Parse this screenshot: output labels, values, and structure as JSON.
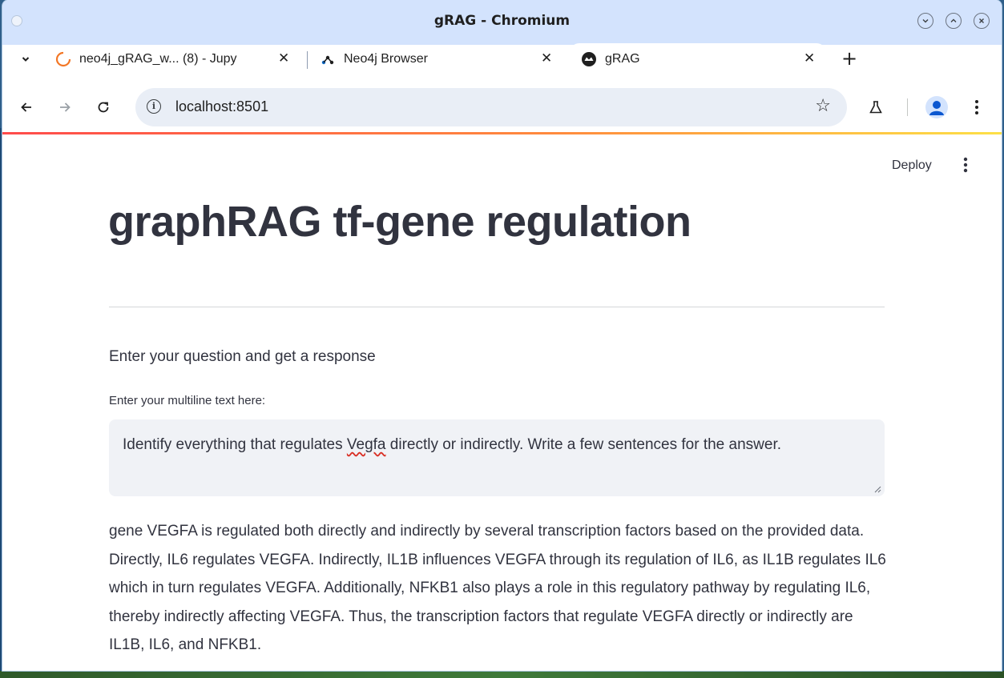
{
  "window": {
    "title": "gRAG - Chromium"
  },
  "tabs": [
    {
      "label": "neo4j_gRAG_w... (8) - Jupy",
      "icon": "jupyter-spinner-icon",
      "active": false
    },
    {
      "label": "Neo4j Browser",
      "icon": "neo4j-icon",
      "active": false
    },
    {
      "label": "gRAG",
      "icon": "streamlit-icon",
      "active": true
    }
  ],
  "toolbar": {
    "url": "localhost:8501"
  },
  "app": {
    "deploy_label": "Deploy",
    "title": "graphRAG tf-gene regulation",
    "subheader": "Enter your question and get a response",
    "input_label": "Enter your multiline text here:",
    "input_value_before": "Identify everything that regulates ",
    "input_value_misspelled": "Vegfa",
    "input_value_after": " directly or indirectly. Write a few sentences for the answer.",
    "answer": "gene VEGFA is regulated both directly and indirectly by several transcription factors based on the provided data. Directly, IL6 regulates VEGFA. Indirectly, IL1B influences VEGFA through its regulation of IL6, as IL1B regulates IL6 which in turn regulates VEGFA. Additionally, NFKB1 also plays a role in this regulatory pathway by regulating IL6, thereby indirectly affecting VEGFA. Thus, the transcription factors that regulate VEGFA directly or indirectly are IL1B, IL6, and NFKB1."
  },
  "colors": {
    "titlebar": "#d3e3fd",
    "streamlit_text": "#31333f",
    "input_bg": "#f0f2f6",
    "accent_red": "#ff4b4b"
  }
}
